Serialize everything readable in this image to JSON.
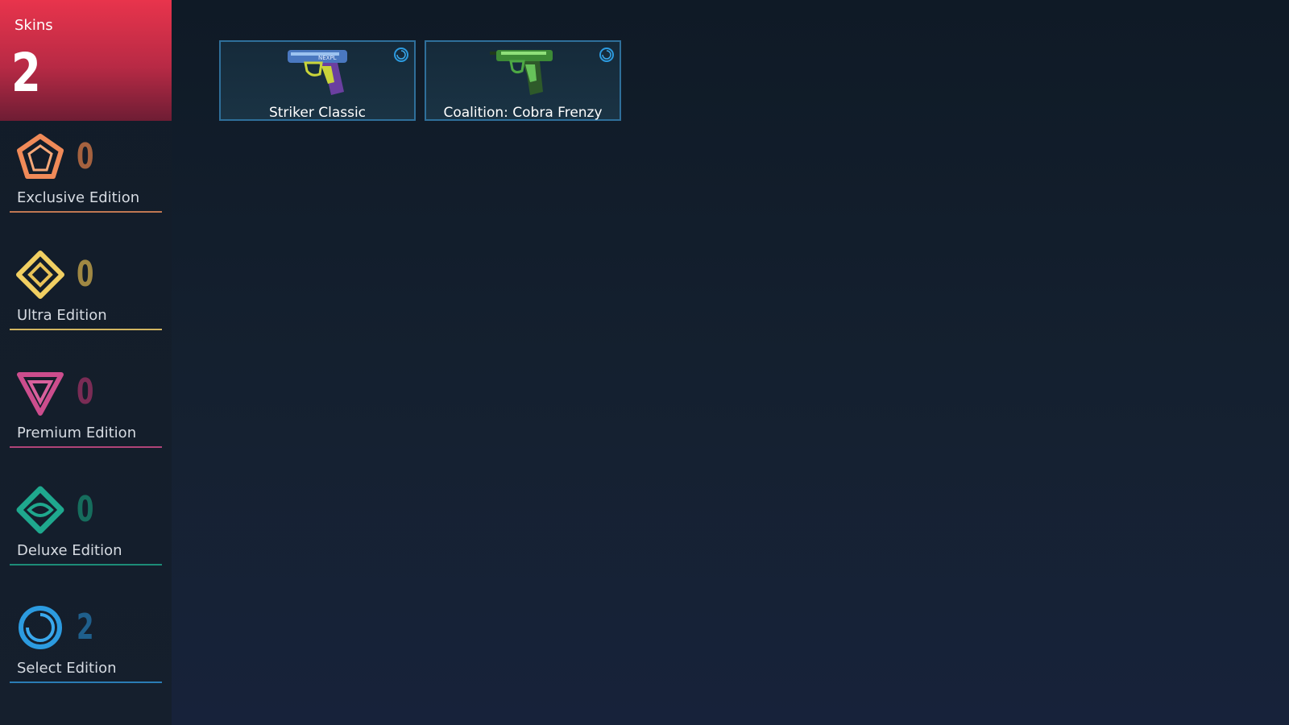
{
  "total": {
    "label": "Skins",
    "count": "2"
  },
  "editions": [
    {
      "label": "Exclusive Edition",
      "count": "0",
      "icon": "exclusive-edition-icon",
      "color": "#f08a58",
      "count_color": "#a5623f",
      "line_color": "#c07752"
    },
    {
      "label": "Ultra Edition",
      "count": "0",
      "icon": "ultra-edition-icon",
      "color": "#f1cf62",
      "count_color": "#a08843",
      "line_color": "#d2b561"
    },
    {
      "label": "Premium Edition",
      "count": "0",
      "icon": "premium-edition-icon",
      "color": "#cc4d8d",
      "count_color": "#7a2c55",
      "line_color": "#b04478"
    },
    {
      "label": "Deluxe Edition",
      "count": "0",
      "icon": "deluxe-edition-icon",
      "color": "#1fa88e",
      "count_color": "#166d5d",
      "line_color": "#1c8c77"
    },
    {
      "label": "Select Edition",
      "count": "2",
      "icon": "select-edition-icon",
      "color": "#2c9be0",
      "count_color": "#1f5f8c",
      "line_color": "#2a7cb5"
    }
  ],
  "skins": [
    {
      "name": "Striker Classic",
      "icon": "pistol-icon",
      "tier_icon": "select-edition-icon"
    },
    {
      "name": "Coalition: Cobra Frenzy",
      "icon": "pistol-icon",
      "tier_icon": "select-edition-icon"
    }
  ]
}
